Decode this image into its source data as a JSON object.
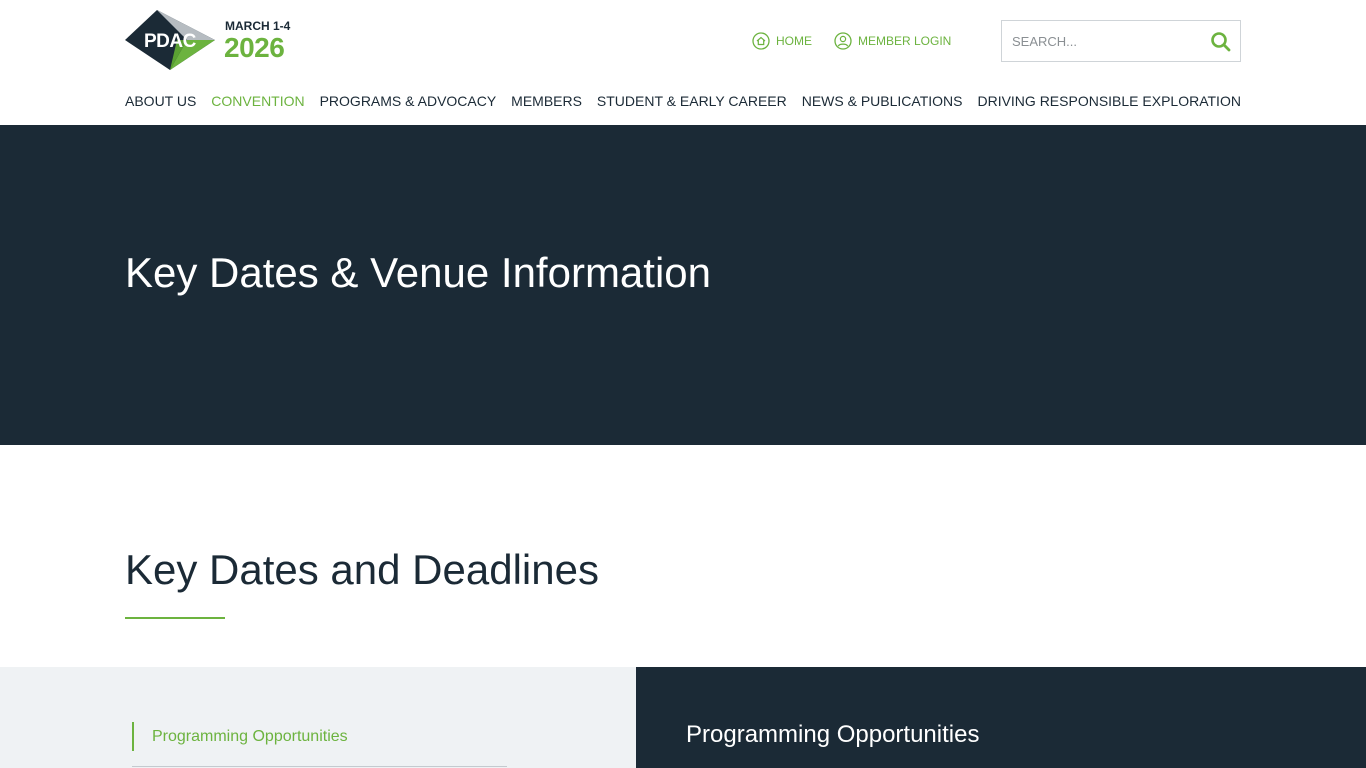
{
  "logo": {
    "text": "PDAC",
    "dates": "MARCH 1-4",
    "year": "2026"
  },
  "utility_nav": {
    "home": "HOME",
    "login": "MEMBER LOGIN"
  },
  "search": {
    "placeholder": "SEARCH..."
  },
  "nav": [
    {
      "label": "ABOUT US",
      "active": false
    },
    {
      "label": "CONVENTION",
      "active": true
    },
    {
      "label": "PROGRAMS & ADVOCACY",
      "active": false
    },
    {
      "label": "MEMBERS",
      "active": false
    },
    {
      "label": "STUDENT & EARLY CAREER",
      "active": false
    },
    {
      "label": "NEWS & PUBLICATIONS",
      "active": false
    },
    {
      "label": "DRIVING RESPONSIBLE EXPLORATION",
      "active": false
    }
  ],
  "hero": {
    "title": "Key Dates & Venue Information"
  },
  "section": {
    "title": "Key Dates and Deadlines"
  },
  "sidebar": {
    "items": [
      {
        "label": "Programming Opportunities"
      }
    ]
  },
  "content": {
    "heading": "Programming Opportunities"
  },
  "colors": {
    "brand_green": "#6cb33f",
    "navy": "#1b2a36",
    "panel_gray": "#eff2f4"
  }
}
